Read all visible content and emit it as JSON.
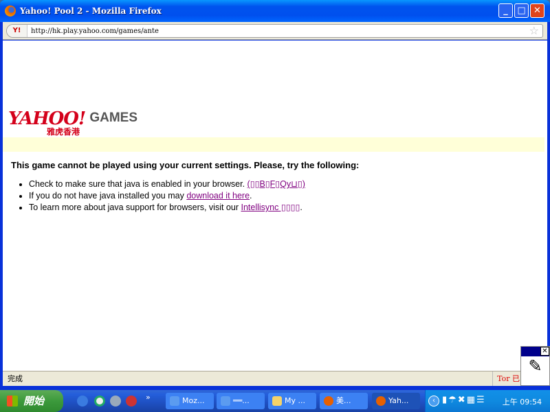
{
  "window": {
    "title": "Yahoo! Pool 2 - Mozilla Firefox",
    "url": "http://hk.play.yahoo.com/games/ante",
    "site_icon": "Y!"
  },
  "page": {
    "logo": {
      "yahoo": "YAHOO!",
      "chinese": "雅虎香港",
      "games": "GAMES"
    },
    "heading": "This game cannot be played using your current settings. Please, try the following:",
    "items": [
      {
        "text": "Check to make sure that java is enabled in your browser. ",
        "link": "(▯▯B▯F▯Qy⊔▯)",
        "after": ""
      },
      {
        "text": "If you do not have java installed you may ",
        "link": "download it here",
        "after": "."
      },
      {
        "text": "To learn more about java support for browsers, visit our ",
        "link": "Intellisync ▯▯▯▯",
        "after": "."
      }
    ]
  },
  "status": {
    "text": "完成",
    "tor": "Tor 已"
  },
  "taskbar": {
    "start": "開始",
    "tasks": [
      "Moz...",
      "══...",
      "My ...",
      "美...",
      "Yah..."
    ],
    "clock": "上午 09:54"
  }
}
